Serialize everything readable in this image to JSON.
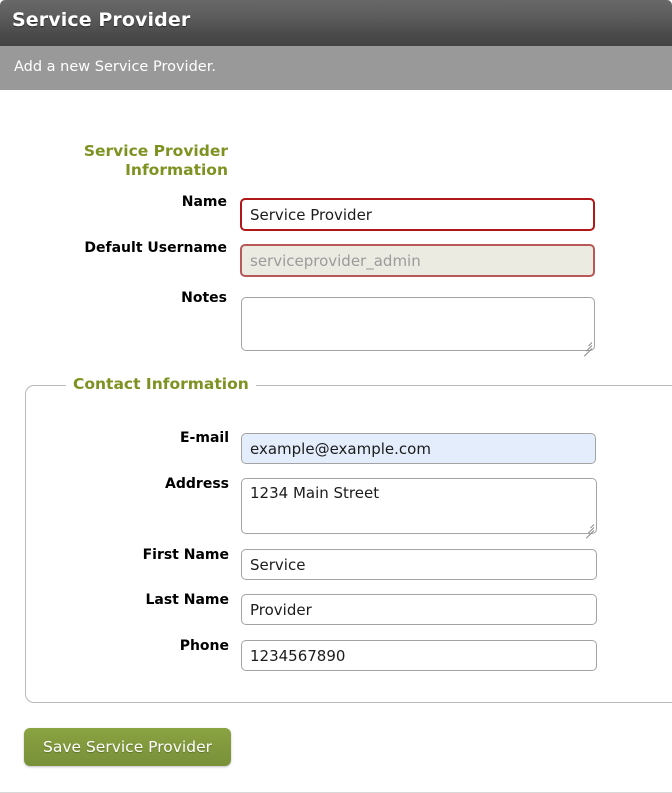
{
  "header": {
    "title": "Service Provider",
    "subtitle": "Add a new Service Provider."
  },
  "provider_section": {
    "heading": "Service Provider Information",
    "fields": [
      {
        "label": "Name",
        "value": "Service Provider",
        "state": "invalid"
      },
      {
        "label": "Default Username",
        "value": "serviceprovider_admin",
        "state": "disabled"
      },
      {
        "label": "Notes",
        "value": "",
        "state": "normal"
      }
    ]
  },
  "contact_section": {
    "legend": "Contact Information",
    "fields": [
      {
        "label": "E-mail",
        "value": "example@example.com",
        "state": "autofilled"
      },
      {
        "label": "Address",
        "value": "1234 Main Street",
        "state": "normal"
      },
      {
        "label": "First Name",
        "value": "Service",
        "state": "normal"
      },
      {
        "label": "Last Name",
        "value": "Provider",
        "state": "normal"
      },
      {
        "label": "Phone",
        "value": "1234567890",
        "state": "normal"
      }
    ]
  },
  "actions": {
    "save_label": "Save Service Provider"
  },
  "colors": {
    "accent_green": "#7d9321",
    "button_green": "#81993c",
    "header_dark": "#4a4a4a",
    "subheader_gray": "#999999",
    "invalid_border": "#b01818",
    "autofill_background": "#e4edfb"
  }
}
